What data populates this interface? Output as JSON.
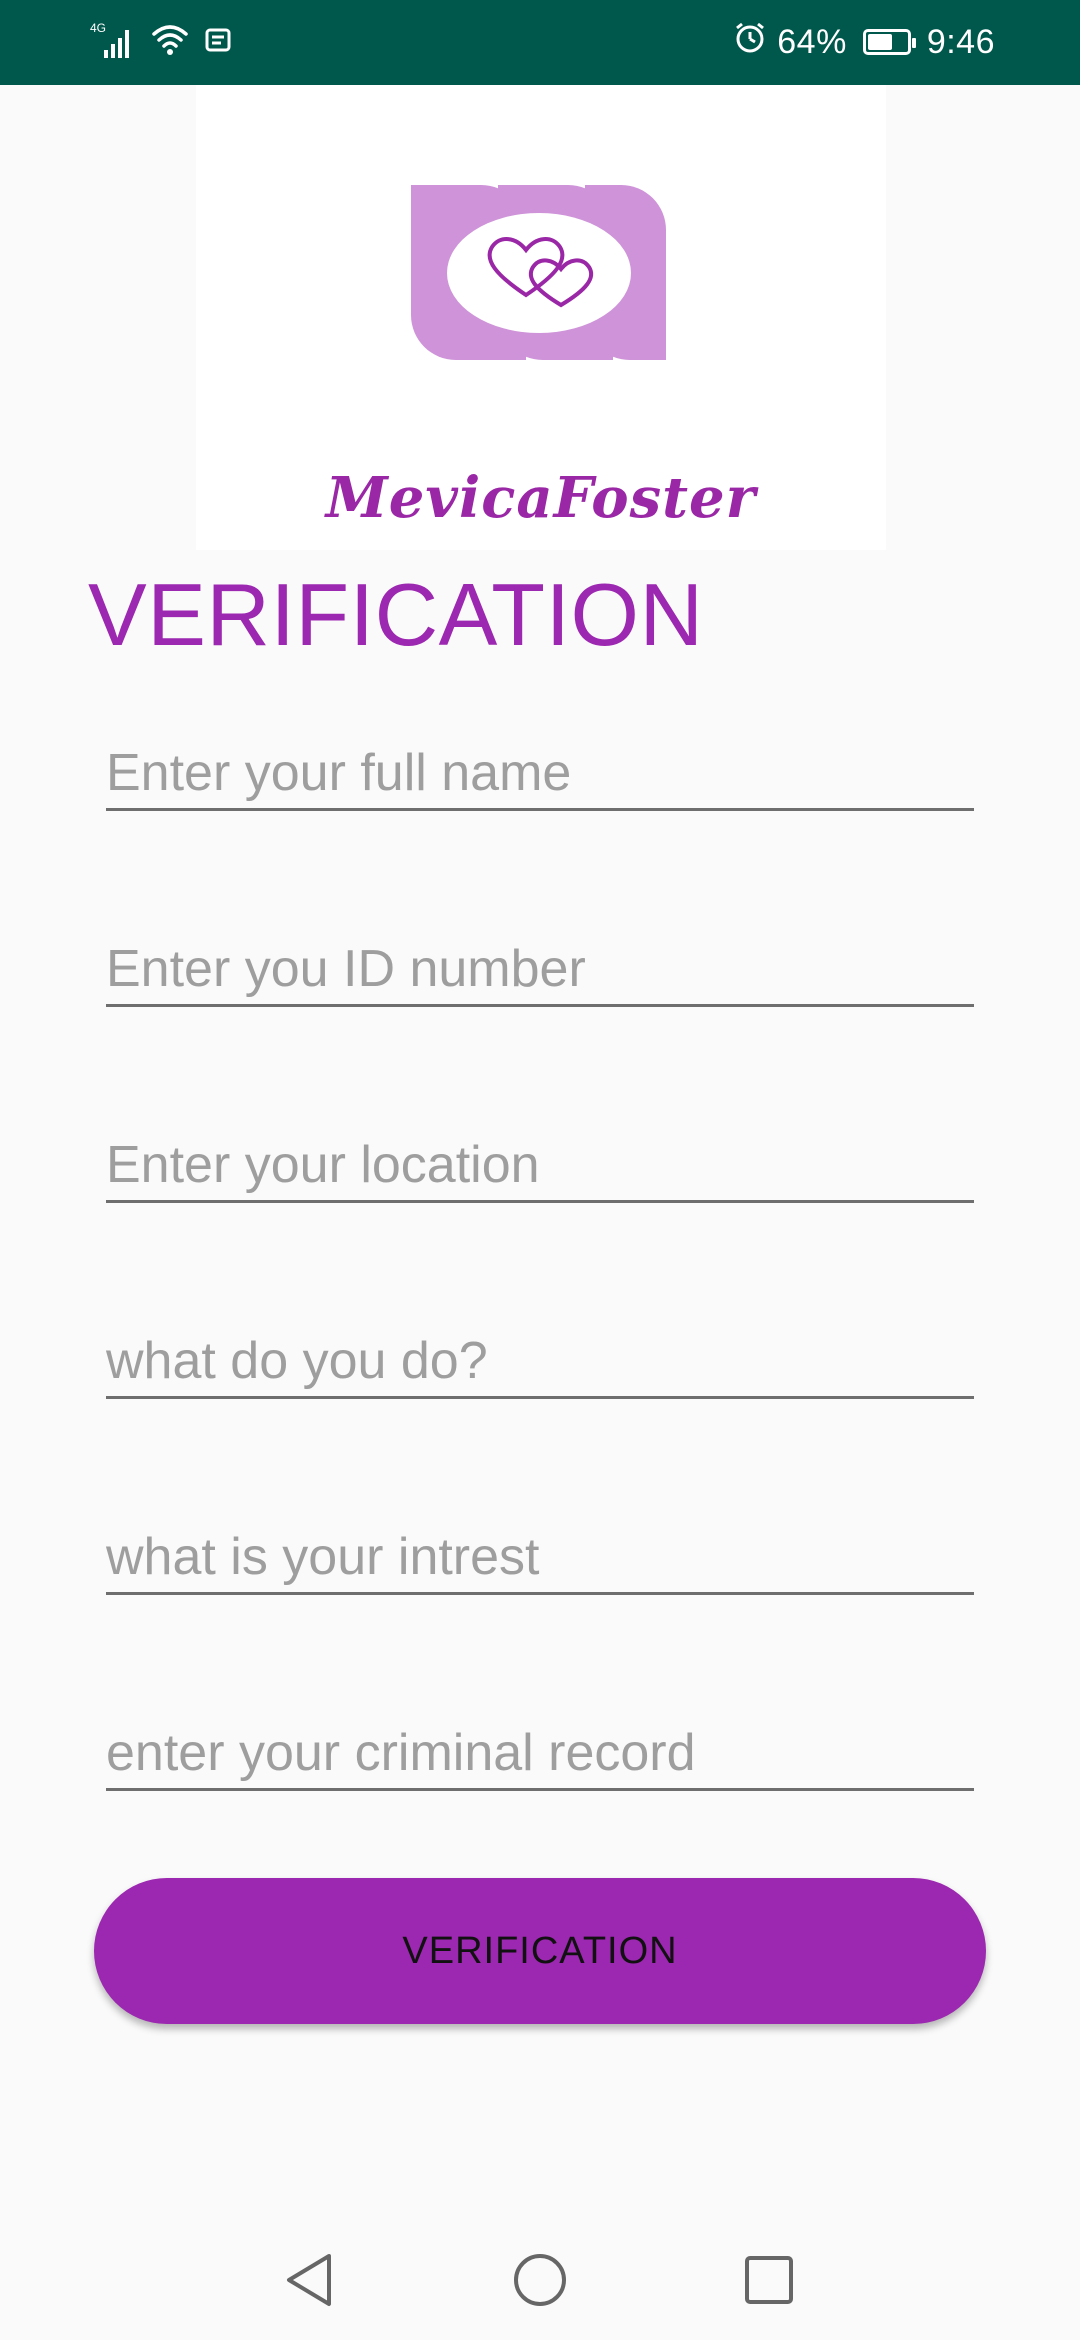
{
  "status_bar": {
    "network": "4G",
    "battery_percent_text": "64%",
    "battery_level": 0.64,
    "time": "9:46",
    "icons": [
      "signal-icon",
      "wifi-icon",
      "notification-icon",
      "alarm-icon",
      "battery-icon"
    ]
  },
  "logo": {
    "text": "MevicaFoster",
    "icon": "hearts-logo-icon",
    "colors": {
      "light": "#ce93d8",
      "dark": "#9a27a6"
    }
  },
  "page": {
    "title": "VERIFICATION"
  },
  "form": {
    "fields": [
      {
        "placeholder": "Enter your full name",
        "value": ""
      },
      {
        "placeholder": "Enter you ID number",
        "value": ""
      },
      {
        "placeholder": "Enter your location",
        "value": ""
      },
      {
        "placeholder": "what do you do?",
        "value": ""
      },
      {
        "placeholder": "what is your intrest",
        "value": ""
      },
      {
        "placeholder": "enter your criminal record",
        "value": ""
      }
    ],
    "submit_label": "VERIFICATION"
  },
  "nav_bar": {
    "icons": [
      "back-icon",
      "home-icon",
      "recents-icon"
    ]
  },
  "colors": {
    "status_bar": "#00574b",
    "accent": "#9c27b0",
    "background": "#fafafa"
  }
}
